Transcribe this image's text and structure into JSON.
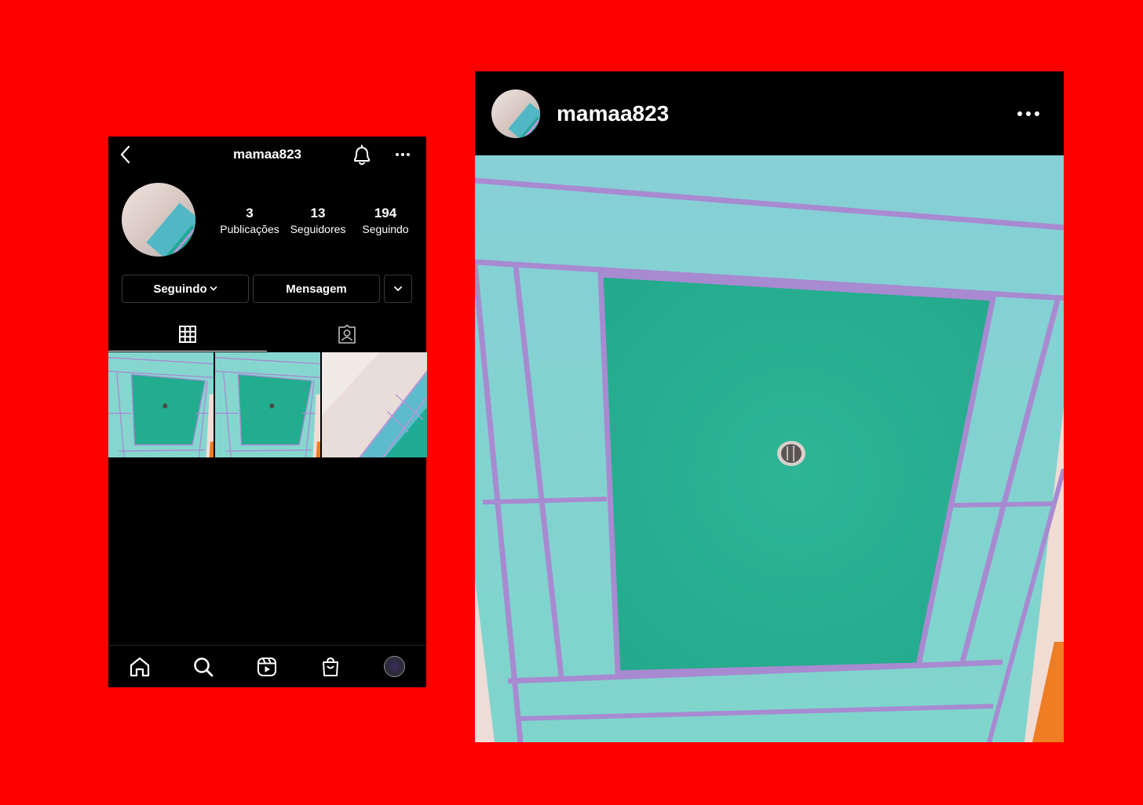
{
  "profile": {
    "username": "mamaa823",
    "stats": [
      {
        "num": "3",
        "label": "Publicações"
      },
      {
        "num": "13",
        "label": "Seguidores"
      },
      {
        "num": "194",
        "label": "Seguindo"
      }
    ],
    "buttons": {
      "follow_label": "Seguindo",
      "message_label": "Mensagem"
    }
  },
  "post": {
    "username": "mamaa823"
  },
  "icons": {
    "back": "chevron-left-icon",
    "bell": "bell-icon",
    "more": "more-horizontal-icon",
    "grid": "grid-icon",
    "tagged": "tagged-person-icon",
    "home": "home-icon",
    "search": "search-icon",
    "reels": "reels-icon",
    "shop": "shopping-bag-icon"
  },
  "colors": {
    "background": "#ff0000",
    "app": "#000000",
    "teal": "#22ad8f",
    "light_teal": "#7fd3cf",
    "purple_line": "#a88ad1"
  }
}
